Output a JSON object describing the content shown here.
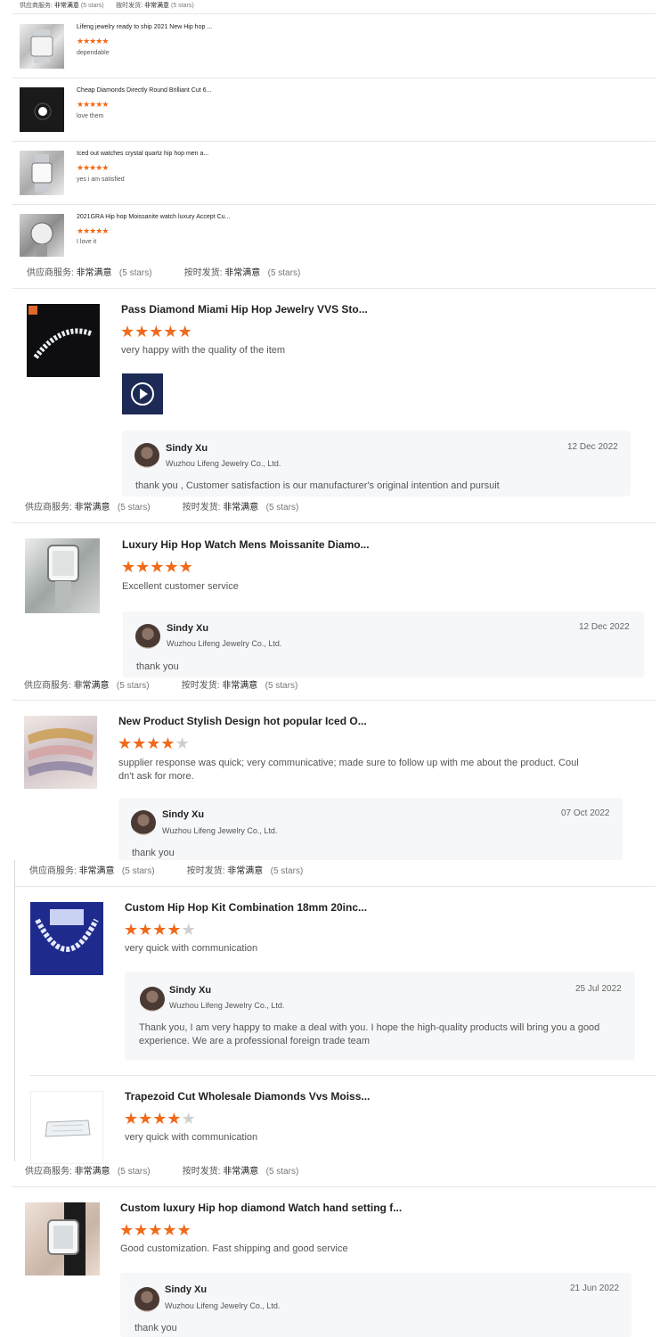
{
  "ratings": {
    "supplier_service_label": "供应商服务:",
    "ship_on_time_label": "按时发货:",
    "very_satisfied": "非常满意",
    "five_stars": "(5 stars)"
  },
  "colors": {
    "star_on": "#f06a1a",
    "star_off": "#cfcfcf",
    "reply_bg": "#f6f7f9"
  },
  "mini_reviews": [
    {
      "title": "Lifeng jewelry ready to ship 2021 New Hip hop ...",
      "stars": 5,
      "comment": "dependable"
    },
    {
      "title": "Cheap Diamonds Directly Round Brilliant Cut 6...",
      "stars": 5,
      "comment": "love them"
    },
    {
      "title": "Iced out watches crystal quartz hip hop men a...",
      "stars": 5,
      "comment": "yes i am satisfied"
    },
    {
      "title": "2021GRA Hip hop Moissanite watch luxury Accept Cu...",
      "stars": 5,
      "comment": "I love it"
    }
  ],
  "reviews": [
    {
      "title": "Pass Diamond Miami Hip Hop Jewelry VVS Sto...",
      "stars": 5,
      "comment": "very happy with the quality of the item",
      "has_video": true,
      "reply": {
        "name": "Sindy Xu",
        "company": "Wuzhou Lifeng Jewelry Co., Ltd.",
        "date": "12 Dec 2022",
        "text": "thank you , Customer satisfaction is our manufacturer's original intention and pursuit"
      }
    },
    {
      "title": "Luxury Hip Hop Watch Mens Moissanite Diamo...",
      "stars": 5,
      "comment": "Excellent customer service",
      "reply": {
        "name": "Sindy Xu",
        "company": "Wuzhou Lifeng Jewelry Co., Ltd.",
        "date": "12 Dec 2022",
        "text": "thank you"
      }
    },
    {
      "title": "New Product Stylish Design hot popular Iced O...",
      "stars": 4,
      "comment_line1": "supplier response was quick; very communicative; made sure to follow up with me about the product. Coul",
      "comment_line2": "dn't ask for more.",
      "reply": {
        "name": "Sindy Xu",
        "company": "Wuzhou Lifeng Jewelry Co., Ltd.",
        "date": "07 Oct 2022",
        "text": "thank you"
      }
    },
    {
      "title": "Custom Hip Hop Kit Combination 18mm 20inc...",
      "stars": 4,
      "comment": "very quick with communication",
      "reply": {
        "name": "Sindy Xu",
        "company": "Wuzhou Lifeng Jewelry Co., Ltd.",
        "date": "25 Jul 2022",
        "text_line1": "Thank you, I am very happy to make a deal with you. I hope the high-quality products will bring you a good",
        "text_line2": "experience. We are a professional foreign trade team"
      }
    },
    {
      "title": "Trapezoid Cut Wholesale Diamonds Vvs Moiss...",
      "stars": 4,
      "comment": "very quick with communication"
    },
    {
      "title": "Custom luxury Hip hop diamond Watch hand setting f...",
      "stars": 5,
      "comment": "Good customization. Fast shipping and good service",
      "reply": {
        "name": "Sindy Xu",
        "company": "Wuzhou Lifeng Jewelry Co., Ltd.",
        "date": "21 Jun 2022",
        "text": "thank you"
      }
    }
  ]
}
